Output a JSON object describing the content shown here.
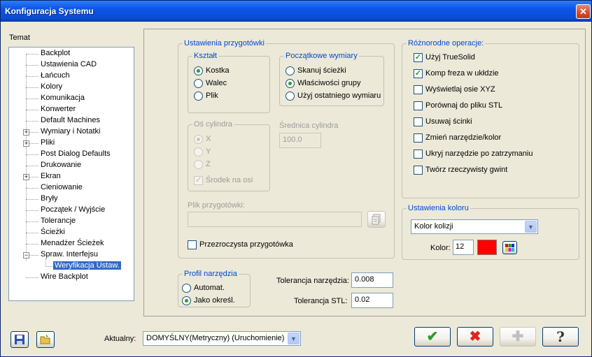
{
  "window": {
    "title": "Konfiguracja Systemu",
    "close_symbol": "✕"
  },
  "sidebar": {
    "label": "Temat",
    "items": [
      {
        "label": "Backplot",
        "expander": ""
      },
      {
        "label": "Ustawienia CAD",
        "expander": ""
      },
      {
        "label": "Łańcuch",
        "expander": ""
      },
      {
        "label": "Kolory",
        "expander": ""
      },
      {
        "label": "Komunikacja",
        "expander": ""
      },
      {
        "label": "Konwerter",
        "expander": ""
      },
      {
        "label": "Default Machines",
        "expander": ""
      },
      {
        "label": "Wymiary i Notatki",
        "expander": "+"
      },
      {
        "label": "Pliki",
        "expander": "+"
      },
      {
        "label": "Post Dialog Defaults",
        "expander": ""
      },
      {
        "label": "Drukowanie",
        "expander": ""
      },
      {
        "label": "Ekran",
        "expander": "+"
      },
      {
        "label": "Cieniowanie",
        "expander": ""
      },
      {
        "label": "Bryły",
        "expander": ""
      },
      {
        "label": "Początek / Wyjście",
        "expander": ""
      },
      {
        "label": "Tolerancje",
        "expander": ""
      },
      {
        "label": "Ścieżki",
        "expander": ""
      },
      {
        "label": "Menadżer Ścieżek",
        "expander": ""
      },
      {
        "label": "Spraw. Interfejsu",
        "expander": "−"
      },
      {
        "label": "Weryfikacja Ustaw.",
        "expander": "",
        "selected": true
      },
      {
        "label": "Wire Backplot",
        "expander": ""
      }
    ]
  },
  "stock": {
    "title": "Ustawienia przygotówki",
    "shape": {
      "title": "Kształt",
      "options": [
        "Kostka",
        "Walec",
        "Plik"
      ],
      "selected": "Kostka"
    },
    "initial": {
      "title": "Początkowe wymiary",
      "options": [
        "Skanuj ścieżki",
        "Właściwości grupy",
        "Użyj ostatniego wymiaru"
      ],
      "selected": "Właściwości grupy"
    },
    "cylinder_axis": {
      "title": "Oś cylindra",
      "options": [
        "X",
        "Y",
        "Z"
      ],
      "selected": "X",
      "center_label": "Środek na osi",
      "center_checked": true
    },
    "diameter": {
      "label": "Średnica cylindra",
      "value": "100.0"
    },
    "file": {
      "label": "Plik przygotówki:",
      "value": ""
    },
    "transparent_label": "Przezroczysta przygotówka",
    "transparent_checked": false
  },
  "misc": {
    "title": "Różnorodne operacje:",
    "items": [
      {
        "label": "Użyj TrueSolid",
        "checked": true
      },
      {
        "label": "Komp freza w ukłdzie",
        "checked": true
      },
      {
        "label": "Wyświetlaj osie XYZ",
        "checked": false
      },
      {
        "label": "Porównaj do pliku STL",
        "checked": false
      },
      {
        "label": "Usuwaj ścinki",
        "checked": false
      },
      {
        "label": "Zmień narzędzie/kolor",
        "checked": false
      },
      {
        "label": "Ukryj narzędzie po zatrzymaniu",
        "checked": false
      },
      {
        "label": "Twórz rzeczywisty gwint",
        "checked": false
      }
    ]
  },
  "color_settings": {
    "title": "Ustawienia koloru",
    "combo_value": "Kolor kolizji",
    "color_label": "Kolor:",
    "color_value": "12",
    "swatch_color": "#ff0000"
  },
  "tool_profile": {
    "title": "Profil narzędzia",
    "options": [
      "Automat.",
      "Jako określ."
    ],
    "selected": "Jako określ."
  },
  "tolerance": {
    "tool_label": "Tolerancja narzędzia:",
    "tool_value": "0.008",
    "stl_label": "Tolerancja STL:",
    "stl_value": "0.02"
  },
  "footer": {
    "current_label": "Aktualny:",
    "current_value": "DOMYŚLNY(Metryczny) (Uruchomienie)",
    "ok_symbol": "✔",
    "cancel_symbol": "✖",
    "add_symbol": "✚",
    "help_symbol": "?",
    "colors": {
      "ok": "#2e9a2e",
      "cancel": "#e0241c"
    }
  }
}
